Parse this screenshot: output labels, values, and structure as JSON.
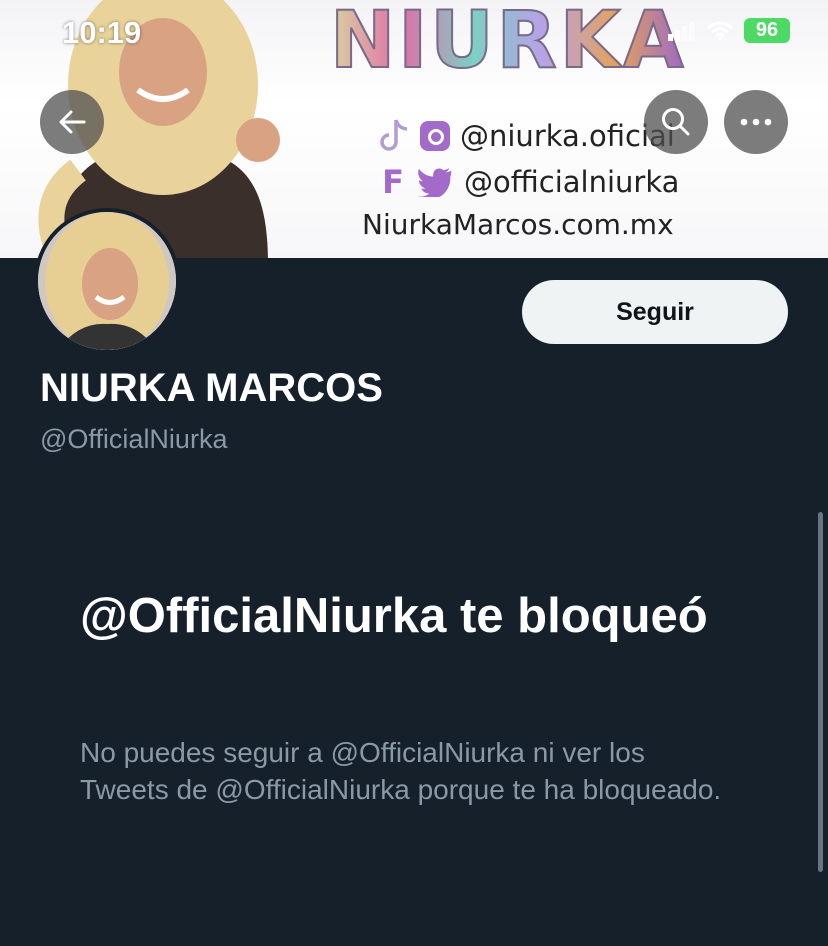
{
  "status_bar": {
    "time": "10:19",
    "battery": "96"
  },
  "banner": {
    "logo_text": "NIURKA",
    "instagram_handle": "@niurka.oficial",
    "twitter_handle": "@officialniurka",
    "website": "NiurkaMarcos.com.mx",
    "facebook_letter": "F"
  },
  "profile": {
    "display_name": "NIURKA MARCOS",
    "handle": "@OfficialNiurka",
    "follow_label": "Seguir"
  },
  "blocked": {
    "title": "@OfficialNiurka te bloqueó",
    "description": "No puedes seguir a @OfficialNiurka ni ver los Tweets de @OfficialNiurka porque te ha bloqueado."
  },
  "colors": {
    "background": "#15202b",
    "secondary_text": "#8b98a5",
    "follow_bg": "#eff3f4",
    "accent_purple": "#a46ac9"
  }
}
